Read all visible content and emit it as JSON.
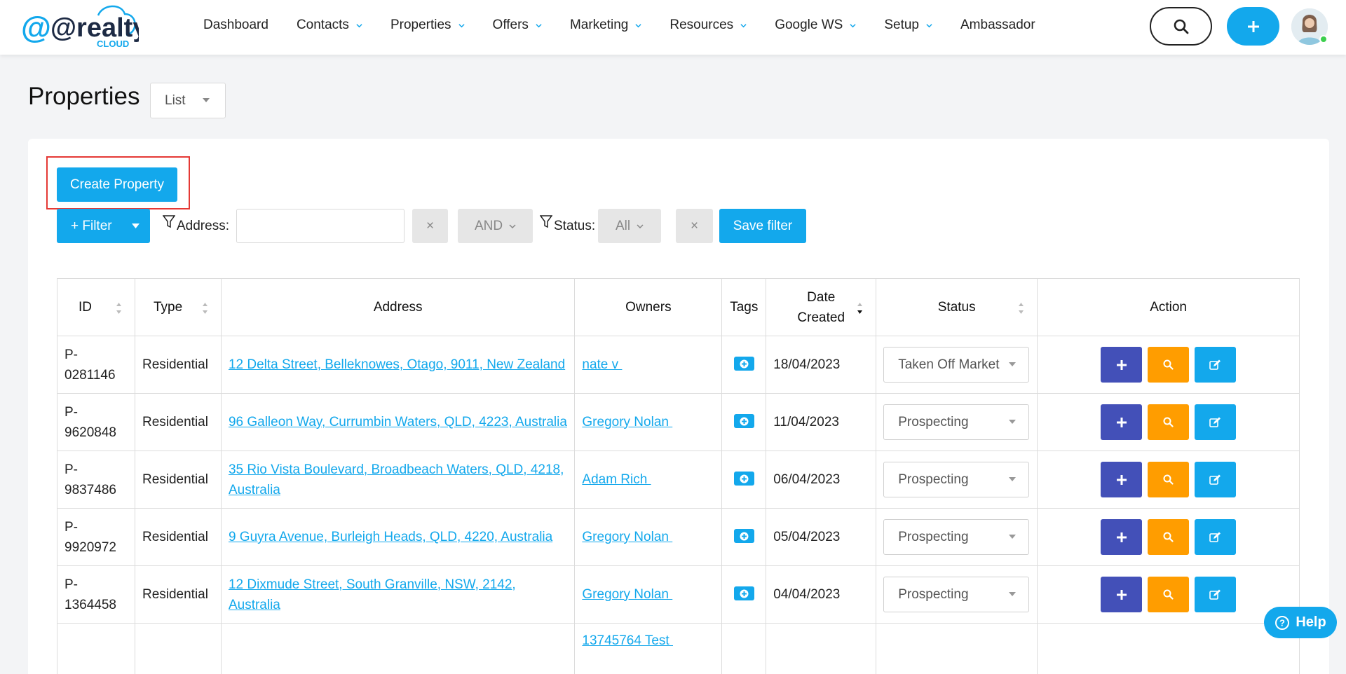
{
  "app": {
    "logo_text": "@realty",
    "logo_sub": "CLOUD"
  },
  "nav": {
    "items": [
      {
        "label": "Dashboard",
        "dropdown": false
      },
      {
        "label": "Contacts",
        "dropdown": true
      },
      {
        "label": "Properties",
        "dropdown": true
      },
      {
        "label": "Offers",
        "dropdown": true
      },
      {
        "label": "Marketing",
        "dropdown": true
      },
      {
        "label": "Resources",
        "dropdown": true
      },
      {
        "label": "Google WS",
        "dropdown": true
      },
      {
        "label": "Setup",
        "dropdown": true
      },
      {
        "label": "Ambassador",
        "dropdown": false
      }
    ]
  },
  "page": {
    "title": "Properties",
    "view_select": "List"
  },
  "toolbar": {
    "create_label": "Create Property",
    "filter_label": "+ Filter",
    "address_label": "Address:",
    "address_value": "",
    "clear_label": "×",
    "and_label": "AND",
    "status_label": "Status:",
    "status_value": "All",
    "save_filter_label": "Save filter"
  },
  "table": {
    "headers": {
      "id": "ID",
      "type": "Type",
      "address": "Address",
      "owners": "Owners",
      "tags": "Tags",
      "date_line1": "Date",
      "date_line2": "Created",
      "status": "Status",
      "action": "Action"
    },
    "rows": [
      {
        "id1": "P-",
        "id2": "0281146",
        "type": "Residential",
        "address": "12 Delta Street, Belleknowes, Otago, 9011, New Zealand",
        "owner": "nate v ",
        "date": "18/04/2023",
        "status": "Taken Off Market"
      },
      {
        "id1": "P-",
        "id2": "9620848",
        "type": "Residential",
        "address": "96 Galleon Way, Currumbin Waters, QLD, 4223, Australia",
        "owner": "Gregory Nolan ",
        "date": "11/04/2023",
        "status": "Prospecting"
      },
      {
        "id1": "P-",
        "id2": "9837486",
        "type": "Residential",
        "address": "35 Rio Vista Boulevard, Broadbeach Waters, QLD, 4218, Australia",
        "owner": "Adam Rich ",
        "date": "06/04/2023",
        "status": "Prospecting"
      },
      {
        "id1": "P-",
        "id2": "9920972",
        "type": "Residential",
        "address": "9 Guyra Avenue, Burleigh Heads, QLD, 4220, Australia",
        "owner": "Gregory Nolan ",
        "date": "05/04/2023",
        "status": "Prospecting"
      },
      {
        "id1": "P-",
        "id2": "1364458",
        "type": "Residential",
        "address": "12 Dixmude Street, South Granville, NSW, 2142, Australia",
        "owner": "Gregory Nolan ",
        "date": "04/04/2023",
        "status": "Prospecting"
      }
    ],
    "partial_row_owner": "13745764 Test "
  },
  "help": {
    "label": "Help"
  },
  "colors": {
    "primary": "#13a8ec",
    "add": "#4350b8",
    "view": "#ff9d00",
    "highlight": "#e53935"
  }
}
